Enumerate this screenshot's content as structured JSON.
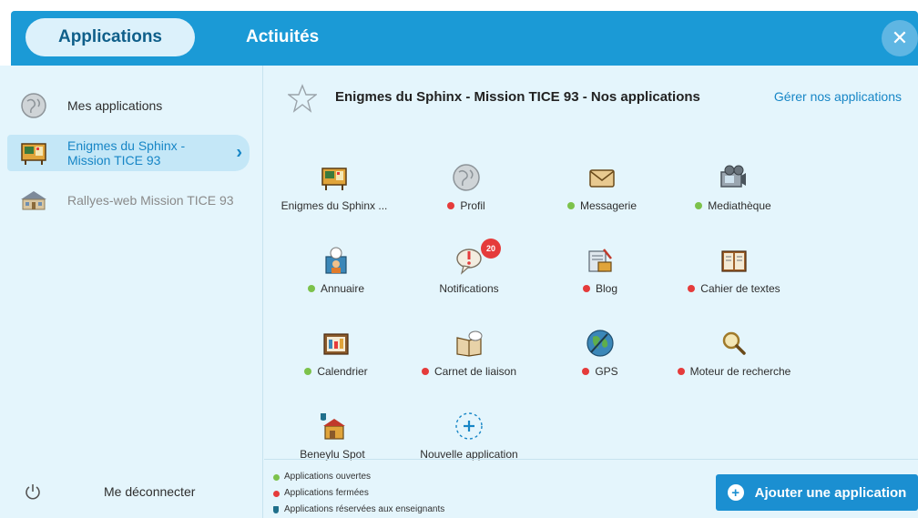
{
  "header": {
    "tabs": [
      {
        "label": "Applications",
        "active": true
      },
      {
        "label": "Actiuités",
        "active": false
      }
    ],
    "close_icon": "close-icon"
  },
  "sidebar": {
    "items": [
      {
        "label": "Mes applications",
        "icon": "globe-avatar-icon"
      },
      {
        "label": "Enigmes du Sphinx - Mission TICE 93",
        "icon": "classroom-board-icon",
        "active": true
      },
      {
        "label": "Rallyes-web Mission TICE 93",
        "icon": "school-building-icon"
      }
    ],
    "logout_label": "Me déconnecter",
    "logout_icon": "power-icon"
  },
  "content": {
    "title": "Enigmes du Sphinx - Mission TICE 93 - Nos applications",
    "manage_link": "Gérer nos applications",
    "apps": [
      {
        "label": "Enigmes du Sphinx ...",
        "status": "none",
        "icon": "classroom-board-icon"
      },
      {
        "label": "Profil",
        "status": "closed",
        "icon": "globe-avatar-icon"
      },
      {
        "label": "Messagerie",
        "status": "open",
        "icon": "envelope-icon"
      },
      {
        "label": "Mediathèque",
        "status": "open",
        "icon": "media-projector-icon"
      },
      {
        "label": "Annuaire",
        "status": "open",
        "icon": "directory-icon"
      },
      {
        "label": "Notifications",
        "status": "none",
        "icon": "notification-bubble-icon",
        "badge": "20"
      },
      {
        "label": "Blog",
        "status": "closed",
        "icon": "blog-icon"
      },
      {
        "label": "Cahier de textes",
        "status": "closed",
        "icon": "textbook-icon"
      },
      {
        "label": "Calendrier",
        "status": "open",
        "icon": "calendar-icon"
      },
      {
        "label": "Carnet de liaison",
        "status": "closed",
        "icon": "liaison-book-icon"
      },
      {
        "label": "GPS",
        "status": "closed",
        "icon": "globe-gps-icon"
      },
      {
        "label": "Moteur de recherche",
        "status": "closed",
        "icon": "magnifier-icon"
      },
      {
        "label": "Beneylu Spot",
        "status": "none",
        "icon": "spot-shop-icon"
      },
      {
        "label": "Nouvelle application",
        "status": "none",
        "icon": "add-app-icon"
      }
    ]
  },
  "footer": {
    "legend": [
      {
        "label": "Applications ouvertes",
        "marker": "green-dot"
      },
      {
        "label": "Applications fermées",
        "marker": "red-dot"
      },
      {
        "label": "Applications réservées aux enseignants",
        "marker": "teacher-shield"
      }
    ],
    "add_button": "Ajouter une application"
  },
  "colors": {
    "header_bg": "#1b9ad6",
    "panel_bg": "#e4f5fc",
    "accent": "#1786c6",
    "open": "#7cc24b",
    "closed": "#e53b3b"
  }
}
